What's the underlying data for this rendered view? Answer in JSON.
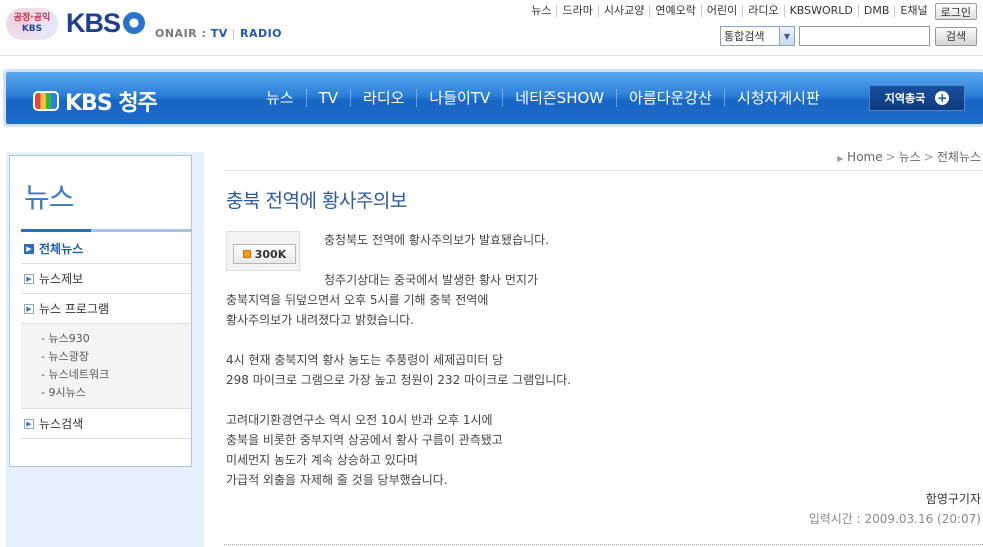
{
  "header": {
    "public_logo_line1": "공정·공익",
    "public_logo_line2": "KBS",
    "brand": "KBS",
    "onair_label": "ONAIR :",
    "onair_tv": "TV",
    "onair_radio": "RADIO",
    "gnb": [
      "뉴스",
      "드라마",
      "시사교양",
      "연예오락",
      "어린이",
      "라디오",
      "KBSWORLD",
      "DMB",
      "E채널"
    ],
    "login_label": "로그인",
    "search_scope": "통합검색",
    "search_value": "",
    "search_button": "검색"
  },
  "nav": {
    "station_name": "KBS 청주",
    "menu": [
      "뉴스",
      "TV",
      "라디오",
      "나들이TV",
      "네티즌SHOW",
      "아름다운강산",
      "시청자게시판"
    ],
    "region_button": "지역총국"
  },
  "sidebar": {
    "title": "뉴스",
    "items": [
      {
        "label": "전체뉴스",
        "active": true
      },
      {
        "label": "뉴스제보",
        "active": false
      },
      {
        "label": "뉴스 프로그램",
        "active": false
      }
    ],
    "sub_items": [
      "- 뉴스930",
      "- 뉴스광장",
      "- 뉴스네트워크",
      "- 9시뉴스"
    ],
    "last_item": "뉴스검색"
  },
  "article": {
    "breadcrumb": [
      "Home",
      "뉴스",
      "전체뉴스"
    ],
    "title": "충북 전역에 황사주의보",
    "views_label": "300K",
    "paragraphs": [
      "충청북도 전역에 황사주의보가 발효됐습니다.",
      "",
      "청주기상대는 중국에서 발생한 황사 먼지가",
      "충북지역을 뒤덮으면서 오후 5시를 기해 충북 전역에",
      "황사주의보가 내려졌다고 밝혔습니다.",
      "",
      "4시 현재 충북지역 황사 농도는 추풍령이 세제곱미터 당",
      "298 마이크로 그램으로 가장 높고 청원이 232 마이크로 그램입니다.",
      "",
      "고려대기환경연구소 역시 오전 10시 반과 오후 1시에",
      "충북을 비롯한 중부지역 상공에서 황사 구름이 관측됐고",
      "미세먼지 농도가 계속 상승하고 있다며",
      "가급적 외출을 자제해 줄 것을 당부했습니다."
    ],
    "byline": "함영구기자",
    "posted": "입력시간 : 2009.03.16 (20:07)"
  },
  "colors": {
    "nav_blue": "#1c6acb",
    "title_blue": "#2b5aa0",
    "sidebar_bg": "#e6f1fb"
  }
}
